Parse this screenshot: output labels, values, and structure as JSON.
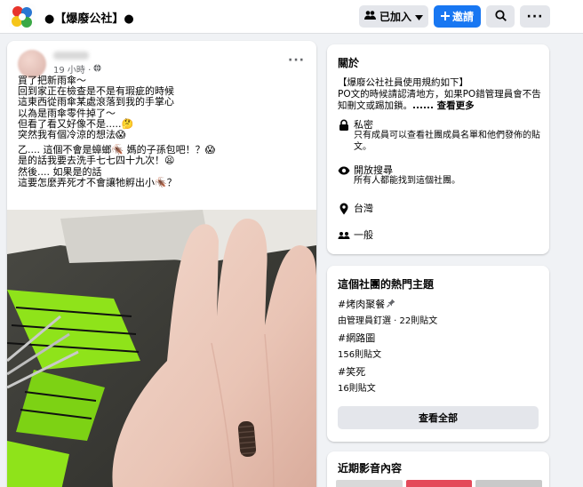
{
  "header": {
    "group_title": "●【爆廢公社】●",
    "joined_label": "已加入",
    "invite_label": "邀請",
    "icons": [
      "group-logo",
      "people-icon",
      "caret-down-icon",
      "plus-icon",
      "search-icon",
      "more-icon"
    ]
  },
  "post": {
    "time": "19 小時 ·",
    "audience_icon": "globe-icon",
    "lines_1": [
      "買了把新雨傘～",
      "回到家正在檢查是不是有瑕疵的時候",
      "這東西從雨傘某處滾落到我的手掌心",
      "以為是雨傘零件掉了～",
      "但看了看又好像不是.....🤔",
      "突然我有個冷涼的想法😱"
    ],
    "lines_2": [
      "乙.... 這個不會是蟑螂🪳 媽的子孫包吧！？😱",
      "是的話我要去洗手七七四十九次！😫",
      "然後.... 如果是的話",
      "這要怎麼弄死才不會讓牠孵出小🪳？"
    ]
  },
  "about": {
    "title": "關於",
    "desc_line1": "【爆廢公社社員使用規約如下】",
    "desc_line2": "PO文的時候請認清地方，如果PO錯管理員會不告",
    "desc_line3": "知刪文或踢加鎖。",
    "see_more": "...... 查看更多",
    "private_title": "私密",
    "private_desc": "只有成員可以查看社團成員名單和他們發佈的貼文。",
    "visible_title": "開放搜尋",
    "visible_desc": "所有人都能找到這個社團。",
    "location": "台灣",
    "category": "一般",
    "icons": [
      "lock-icon",
      "eye-icon",
      "location-pin-icon",
      "group-icon"
    ]
  },
  "topics": {
    "title": "這個社團的熱門主題",
    "items": [
      {
        "tag": "#烤肉聚餐",
        "sub": "由管理員釘選 · 22則貼文"
      },
      {
        "tag": "#網路圖",
        "sub": "156則貼文"
      },
      {
        "tag": "#笑死",
        "sub": "16則貼文"
      }
    ],
    "see_all": "查看全部"
  },
  "media": {
    "title": "近期影音內容"
  },
  "colors": {
    "accent": "#1877f2",
    "background": "#f0f2f5",
    "button_grey": "#e4e6eb",
    "text_secondary": "#65676b"
  }
}
